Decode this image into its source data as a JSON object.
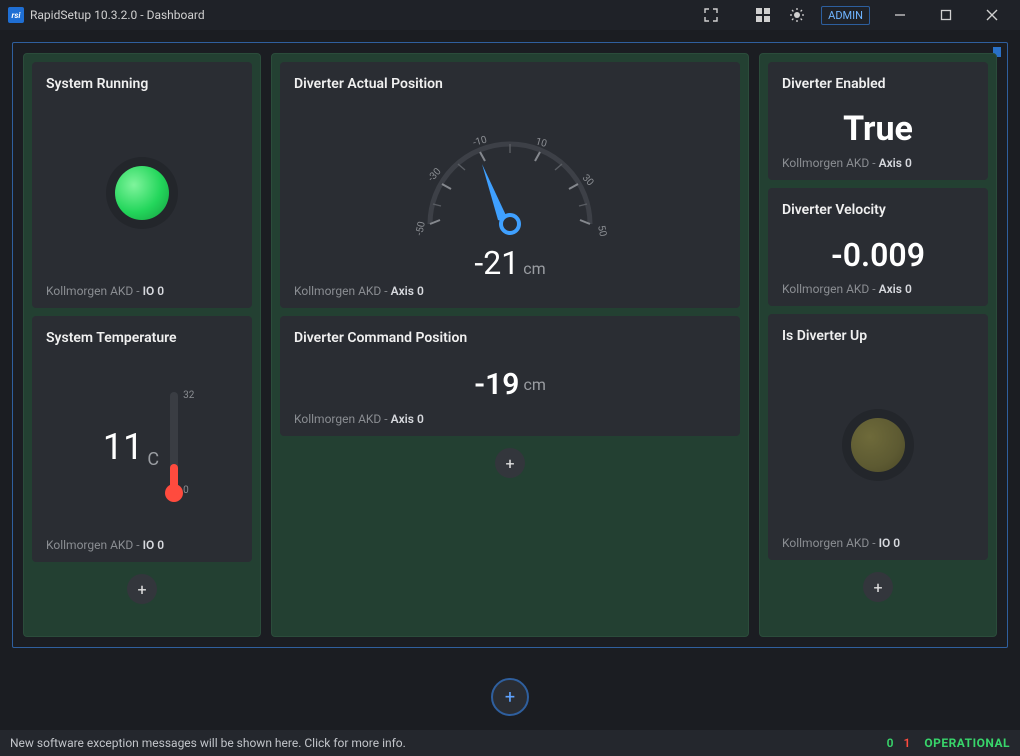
{
  "window": {
    "title": "RapidSetup 10.3.2.0 - Dashboard",
    "admin_label": "ADMIN",
    "logo_text": "rsi"
  },
  "icons": {
    "compress": "⤢",
    "grid": "▦",
    "sun": "☀",
    "minimize": "—",
    "maximize": "☐",
    "close": "✕",
    "plus": "+"
  },
  "columns": {
    "a": {
      "cards": [
        {
          "title": "System Running",
          "source_prefix": "Kollmorgen AKD - ",
          "source_bold": "IO 0",
          "led_on": true
        },
        {
          "title": "System Temperature",
          "source_prefix": "Kollmorgen AKD - ",
          "source_bold": "IO 0",
          "value": "11",
          "unit": "C",
          "scale_max": "32",
          "scale_min": "0"
        }
      ]
    },
    "b": {
      "cards": [
        {
          "title": "Diverter Actual Position",
          "source_prefix": "Kollmorgen AKD - ",
          "source_bold": "Axis 0",
          "value": "-21",
          "unit": "cm",
          "ticks": [
            "-50",
            "-30",
            "-10",
            "10",
            "30",
            "50"
          ]
        },
        {
          "title": "Diverter Command Position",
          "source_prefix": "Kollmorgen AKD - ",
          "source_bold": "Axis 0",
          "value": "-19",
          "unit": "cm"
        }
      ]
    },
    "c": {
      "cards": [
        {
          "title": "Diverter Enabled",
          "source_prefix": "Kollmorgen AKD - ",
          "source_bold": "Axis 0",
          "value": "True"
        },
        {
          "title": "Diverter Velocity",
          "source_prefix": "Kollmorgen AKD - ",
          "source_bold": "Axis 0",
          "value": "-0.009"
        },
        {
          "title": "Is Diverter Up",
          "source_prefix": "Kollmorgen AKD - ",
          "source_bold": "IO 0",
          "led_on": false
        }
      ]
    }
  },
  "statusbar": {
    "message": "New software exception messages will be shown here. Click for more info.",
    "count_ok": "0",
    "count_err": "1",
    "state": "OPERATIONAL"
  }
}
